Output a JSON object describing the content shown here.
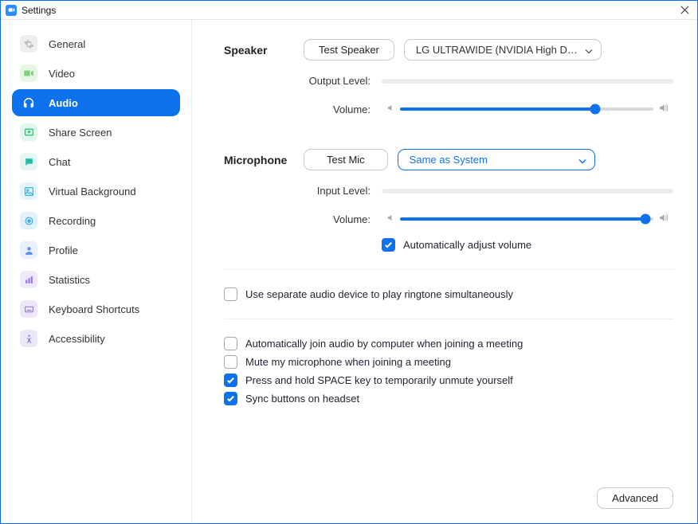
{
  "window": {
    "title": "Settings"
  },
  "sidebar": {
    "items": [
      {
        "label": "General"
      },
      {
        "label": "Video"
      },
      {
        "label": "Audio"
      },
      {
        "label": "Share Screen"
      },
      {
        "label": "Chat"
      },
      {
        "label": "Virtual Background"
      },
      {
        "label": "Recording"
      },
      {
        "label": "Profile"
      },
      {
        "label": "Statistics"
      },
      {
        "label": "Keyboard Shortcuts"
      },
      {
        "label": "Accessibility"
      }
    ]
  },
  "audio": {
    "speaker": {
      "heading": "Speaker",
      "test_label": "Test Speaker",
      "device": "LG ULTRAWIDE (NVIDIA High Defi...",
      "output_level_label": "Output Level:",
      "volume_label": "Volume:",
      "volume_percent": 77
    },
    "mic": {
      "heading": "Microphone",
      "test_label": "Test Mic",
      "device": "Same as System",
      "input_level_label": "Input Level:",
      "volume_label": "Volume:",
      "volume_percent": 97,
      "auto_adjust_label": "Automatically adjust volume",
      "auto_adjust_checked": true
    },
    "ringtone": {
      "label": "Use separate audio device to play ringtone simultaneously",
      "checked": false
    },
    "options": [
      {
        "label": "Automatically join audio by computer when joining a meeting",
        "checked": false
      },
      {
        "label": "Mute my microphone when joining a meeting",
        "checked": false
      },
      {
        "label": "Press and hold SPACE key to temporarily unmute yourself",
        "checked": true
      },
      {
        "label": "Sync buttons on headset",
        "checked": true
      }
    ],
    "advanced_label": "Advanced"
  }
}
